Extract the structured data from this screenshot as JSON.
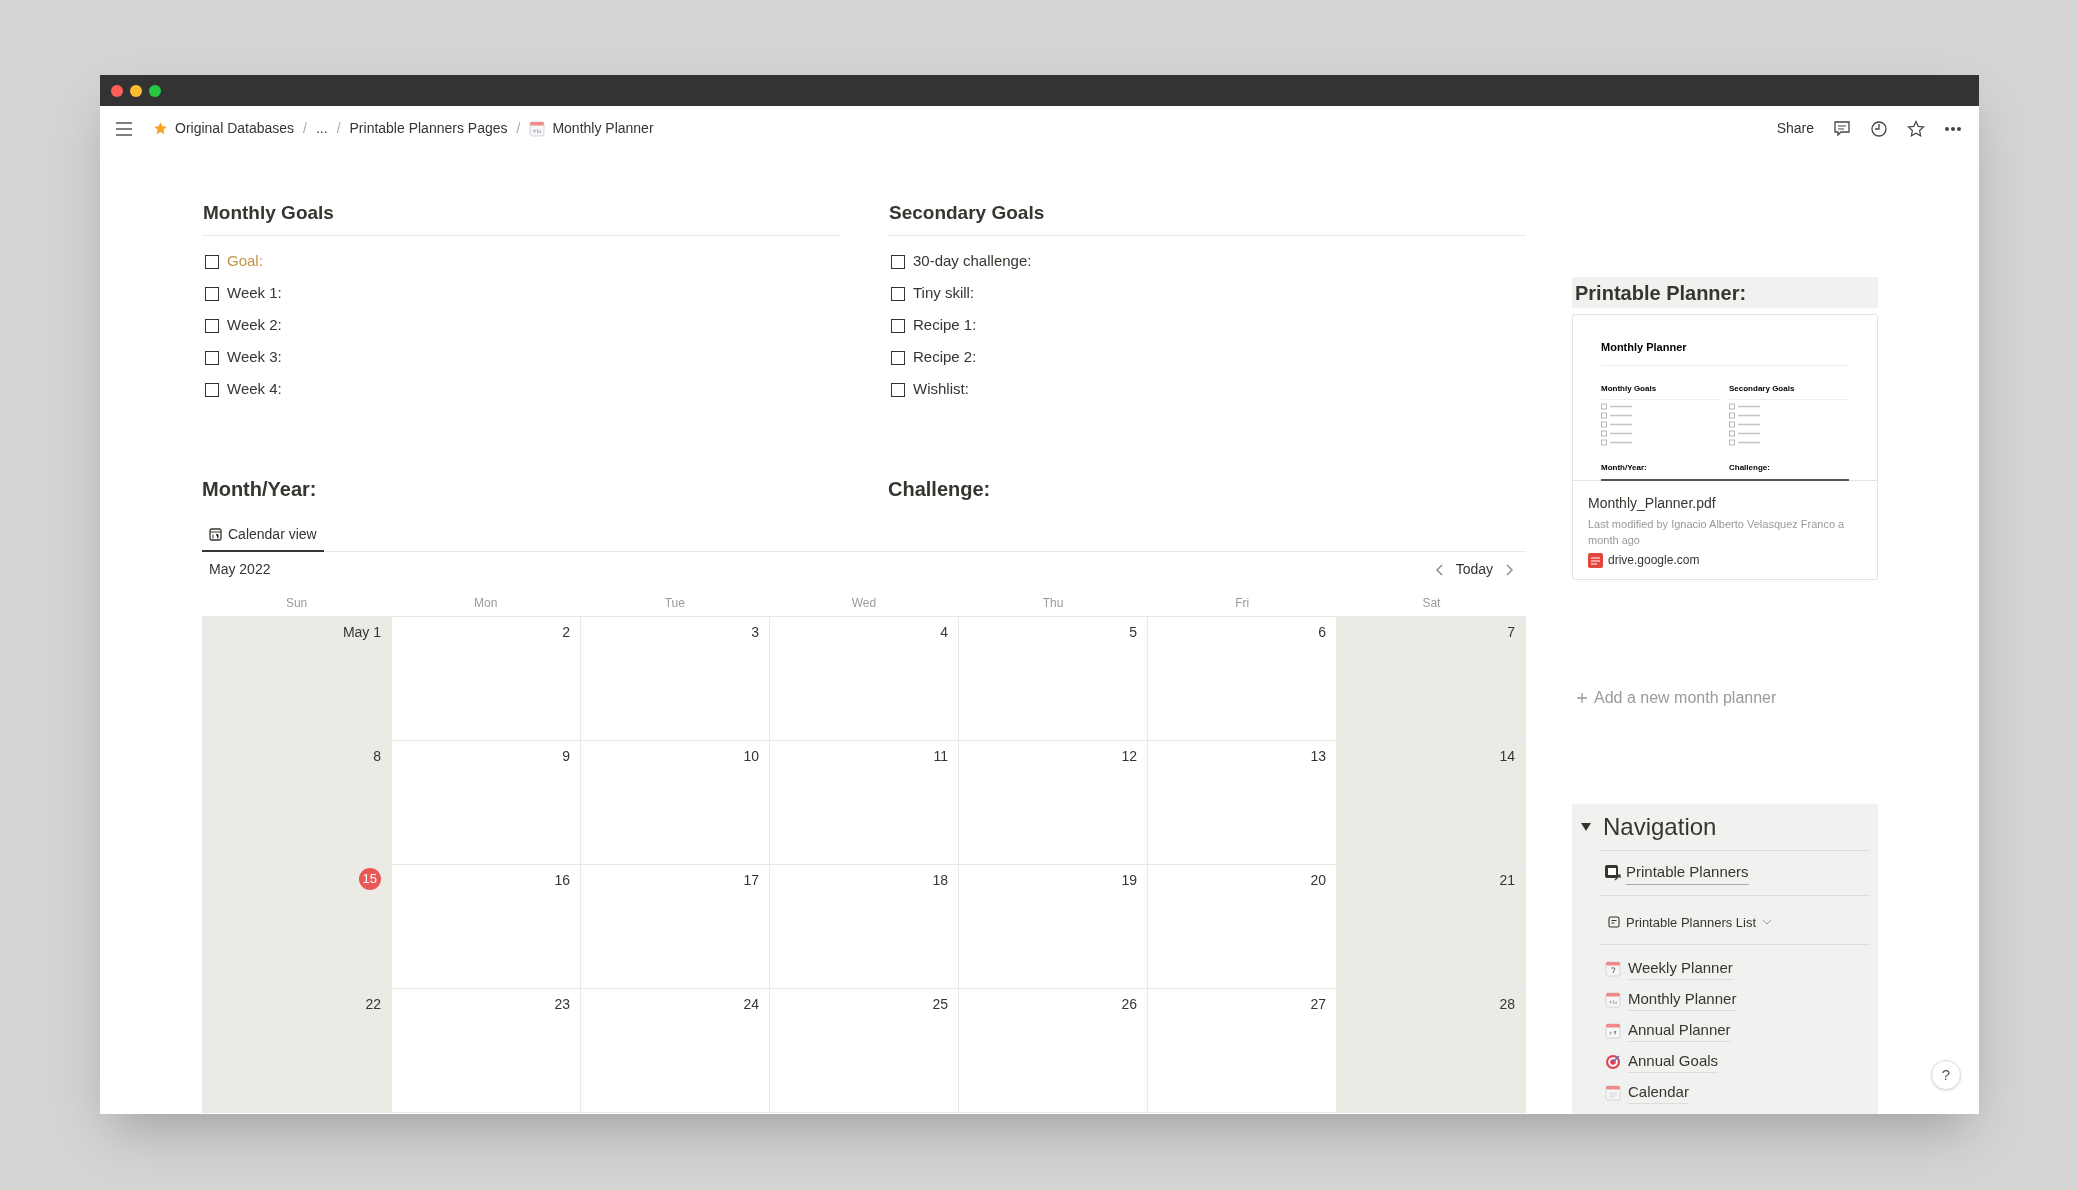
{
  "breadcrumb": [
    {
      "label": "Original Databases",
      "kind": "favorite"
    },
    {
      "label": "/",
      "kind": "separator"
    },
    {
      "label": "...",
      "kind": "plain"
    },
    {
      "label": "/",
      "kind": "separator"
    },
    {
      "label": "Printable Planners Pages",
      "kind": "plain"
    },
    {
      "label": "/",
      "kind": "separator"
    },
    {
      "label": "Monthly Planner",
      "kind": "month"
    }
  ],
  "topbar_actions": {
    "share": "Share"
  },
  "goals": [
    {
      "title": "Monthly Goals",
      "items": [
        {
          "label": "Goal:",
          "checked": false,
          "color": "#c29343"
        },
        {
          "label": "Week 1:",
          "checked": false,
          "color": "#37352f"
        },
        {
          "label": "Week 2:",
          "checked": false,
          "color": "#37352f"
        },
        {
          "label": "Week 3:",
          "checked": false,
          "color": "#37352f"
        },
        {
          "label": "Week 4:",
          "checked": false,
          "color": "#37352f"
        }
      ]
    },
    {
      "title": "Secondary Goals",
      "items": [
        {
          "label": "30-day challenge:",
          "checked": false,
          "color": "#37352f"
        },
        {
          "label": "Tiny skill:",
          "checked": false,
          "color": "#37352f"
        },
        {
          "label": "Recipe 1:",
          "checked": false,
          "color": "#37352f"
        },
        {
          "label": "Recipe 2:",
          "checked": false,
          "color": "#37352f"
        },
        {
          "label": "Wishlist:",
          "checked": false,
          "color": "#37352f"
        }
      ]
    }
  ],
  "headings": [
    "Month/Year:",
    "Challenge:"
  ],
  "calendar": {
    "tabs": [
      {
        "label": "Calendar view",
        "selected": true
      }
    ],
    "month": "May 2022",
    "today_button": "Today",
    "weekdays": [
      "Sun",
      "Mon",
      "Tue",
      "Wed",
      "Thu",
      "Fri",
      "Sat"
    ],
    "weeks": [
      [
        {
          "label": "May 1",
          "weekend": true,
          "today": false
        },
        {
          "label": "2",
          "weekend": false,
          "today": false
        },
        {
          "label": "3",
          "weekend": false,
          "today": false
        },
        {
          "label": "4",
          "weekend": false,
          "today": false
        },
        {
          "label": "5",
          "weekend": false,
          "today": false
        },
        {
          "label": "6",
          "weekend": false,
          "today": false
        },
        {
          "label": "7",
          "weekend": true,
          "today": false
        }
      ],
      [
        {
          "label": "8",
          "weekend": true,
          "today": false
        },
        {
          "label": "9",
          "weekend": false,
          "today": false
        },
        {
          "label": "10",
          "weekend": false,
          "today": false
        },
        {
          "label": "11",
          "weekend": false,
          "today": false
        },
        {
          "label": "12",
          "weekend": false,
          "today": false
        },
        {
          "label": "13",
          "weekend": false,
          "today": false
        },
        {
          "label": "14",
          "weekend": true,
          "today": false
        }
      ],
      [
        {
          "label": "15",
          "weekend": true,
          "today": true
        },
        {
          "label": "16",
          "weekend": false,
          "today": false
        },
        {
          "label": "17",
          "weekend": false,
          "today": false
        },
        {
          "label": "18",
          "weekend": false,
          "today": false
        },
        {
          "label": "19",
          "weekend": false,
          "today": false
        },
        {
          "label": "20",
          "weekend": false,
          "today": false
        },
        {
          "label": "21",
          "weekend": true,
          "today": false
        }
      ],
      [
        {
          "label": "22",
          "weekend": true,
          "today": false
        },
        {
          "label": "23",
          "weekend": false,
          "today": false
        },
        {
          "label": "24",
          "weekend": false,
          "today": false
        },
        {
          "label": "25",
          "weekend": false,
          "today": false
        },
        {
          "label": "26",
          "weekend": false,
          "today": false
        },
        {
          "label": "27",
          "weekend": false,
          "today": false
        },
        {
          "label": "28",
          "weekend": true,
          "today": false
        }
      ]
    ]
  },
  "sidebar": {
    "title": "Printable Planner:",
    "bookmark": {
      "preview": {
        "title": "Monthly Planner",
        "columns": [
          "Monthly Goals",
          "Secondary Goals"
        ],
        "footer": [
          "Month/Year:",
          "Challenge:"
        ]
      },
      "file": "Monthly_Planner.pdf",
      "meta": "Last modified by Ignacio Alberto Velasquez Franco a month ago",
      "source": "drive.google.com"
    },
    "add_button": "Add a new month planner",
    "navigation": {
      "title": "Navigation",
      "expanded": true,
      "link": "Printable Planners",
      "list_title": "Printable Planners List",
      "items": [
        {
          "label": "Weekly Planner",
          "kind": "week"
        },
        {
          "label": "Monthly Planner",
          "kind": "month"
        },
        {
          "label": "Annual Planner",
          "kind": "year"
        },
        {
          "label": "Annual Goals",
          "kind": "goals"
        },
        {
          "label": "Calendar",
          "kind": "calendar"
        }
      ]
    }
  },
  "help": "?"
}
